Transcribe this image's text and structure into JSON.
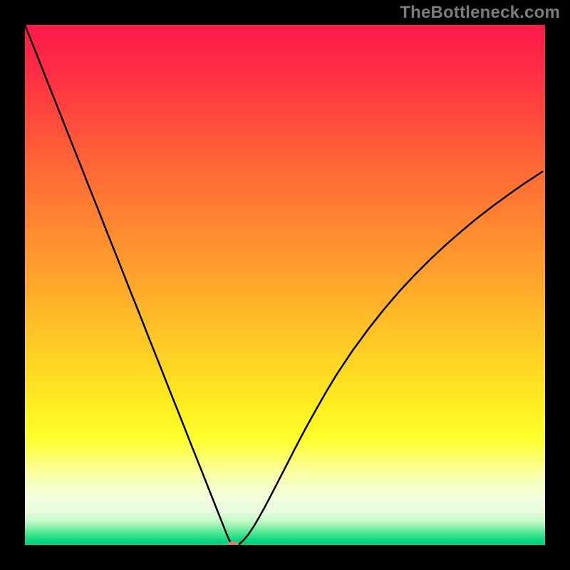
{
  "watermark": "TheBottleneck.com",
  "gradient": {
    "stops": [
      {
        "offset": 0.0,
        "color": "#ff1a4a"
      },
      {
        "offset": 0.08,
        "color": "#ff2b45"
      },
      {
        "offset": 0.18,
        "color": "#ff4a3c"
      },
      {
        "offset": 0.28,
        "color": "#ff6a35"
      },
      {
        "offset": 0.38,
        "color": "#ff8630"
      },
      {
        "offset": 0.48,
        "color": "#ffa22b"
      },
      {
        "offset": 0.58,
        "color": "#ffc028"
      },
      {
        "offset": 0.66,
        "color": "#ffd823"
      },
      {
        "offset": 0.74,
        "color": "#fff020"
      },
      {
        "offset": 0.8,
        "color": "#ffff30"
      },
      {
        "offset": 0.86,
        "color": "#faffa0"
      },
      {
        "offset": 0.9,
        "color": "#f4ffd8"
      },
      {
        "offset": 0.935,
        "color": "#e8fce0"
      },
      {
        "offset": 0.955,
        "color": "#c0f8c4"
      },
      {
        "offset": 0.975,
        "color": "#58e896"
      },
      {
        "offset": 0.99,
        "color": "#10d884"
      },
      {
        "offset": 1.0,
        "color": "#04d07c"
      }
    ]
  },
  "chart_data": {
    "type": "line",
    "title": "",
    "xlabel": "",
    "ylabel": "",
    "xlim": [
      0,
      100
    ],
    "ylim": [
      0,
      100
    ],
    "grid": false,
    "marker": {
      "x": 40,
      "y": 0,
      "color": "#cf8276"
    },
    "series": [
      {
        "name": "curve",
        "x": [
          0,
          2,
          4,
          6,
          8,
          10,
          12,
          14,
          16,
          18,
          20,
          22,
          24,
          26,
          28,
          30,
          32,
          34,
          35.5,
          37,
          38,
          38.7,
          39.3,
          40,
          41,
          42,
          43,
          44,
          45,
          46,
          48,
          50,
          52,
          54,
          56,
          58,
          60,
          63,
          66,
          69,
          72,
          75,
          78,
          81,
          84,
          87,
          90,
          93,
          96,
          99.5
        ],
        "y": [
          100,
          95.0,
          89.9,
          84.9,
          79.8,
          74.8,
          69.7,
          64.7,
          59.6,
          54.6,
          49.5,
          44.5,
          39.4,
          34.4,
          29.3,
          24.3,
          19.2,
          14.2,
          10.4,
          6.6,
          4.1,
          2.3,
          0.9,
          0.0,
          0.0,
          0.9,
          2.1,
          3.6,
          5.3,
          7.1,
          10.9,
          14.8,
          18.7,
          22.5,
          26.1,
          29.6,
          32.9,
          37.4,
          41.5,
          45.3,
          48.8,
          52.0,
          55.0,
          57.8,
          60.4,
          62.9,
          65.2,
          67.4,
          69.5,
          71.8
        ]
      }
    ]
  }
}
